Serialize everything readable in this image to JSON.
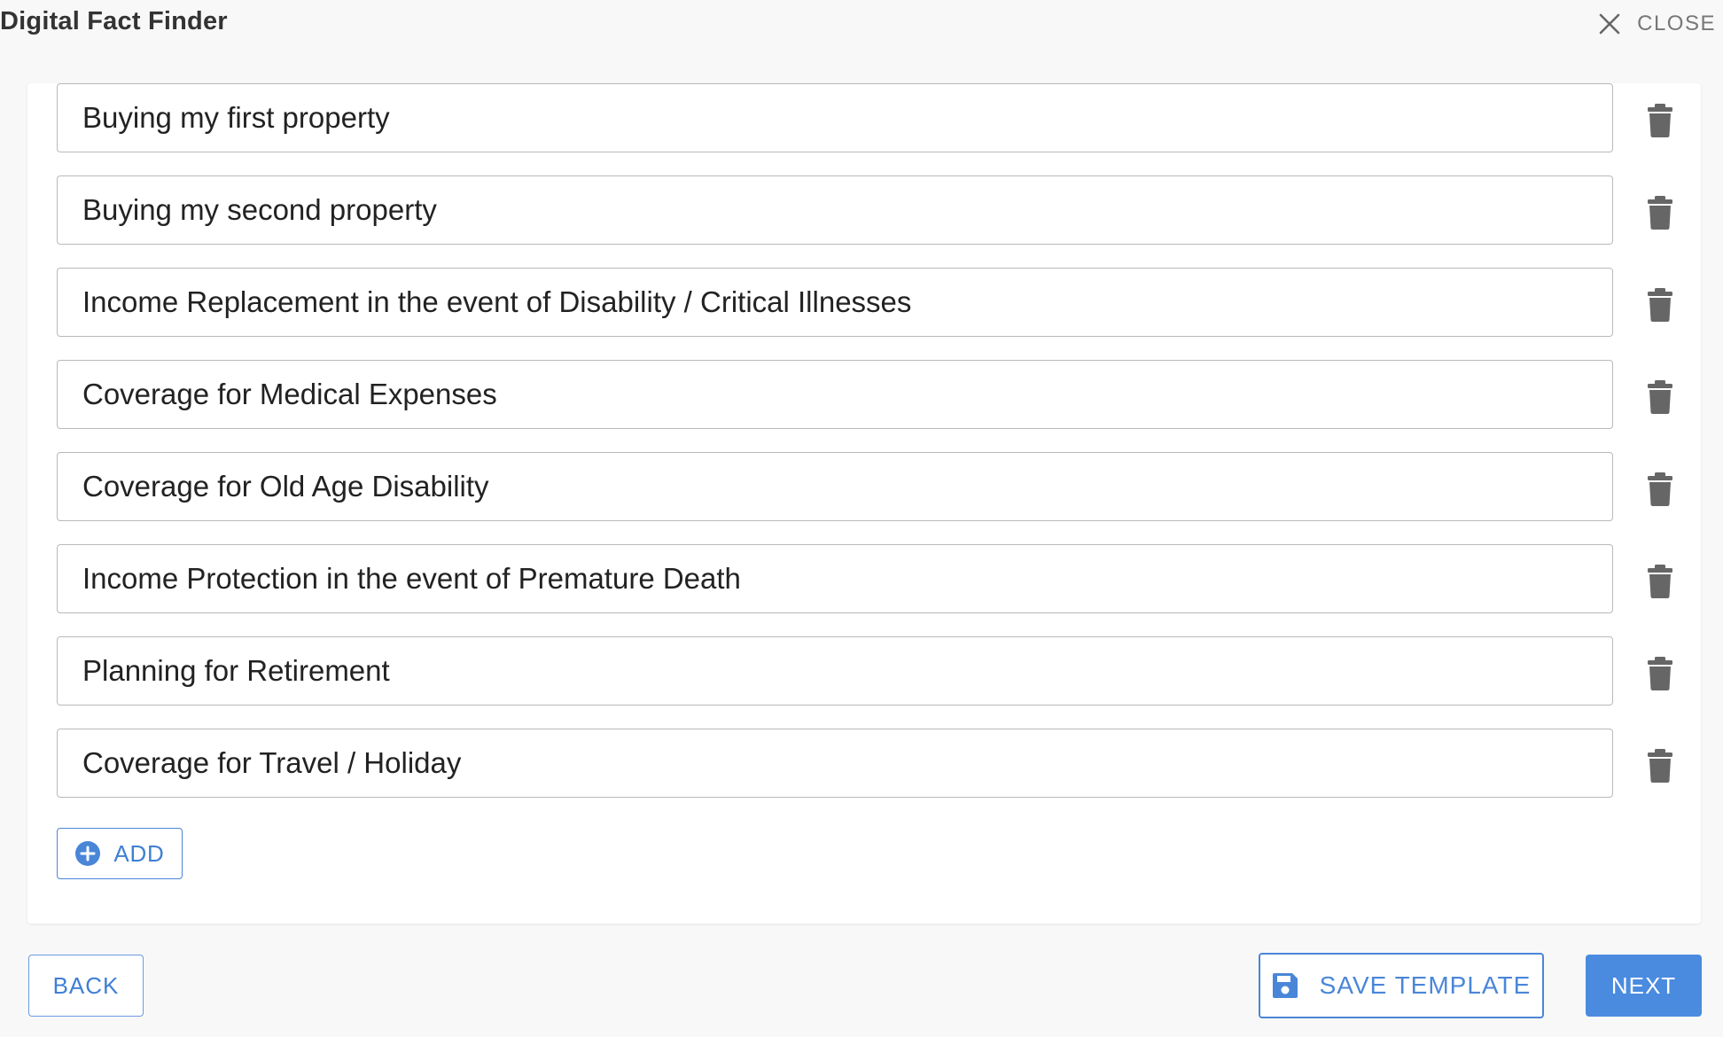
{
  "header": {
    "title": "Digital Fact Finder",
    "close_label": "CLOSE",
    "close_icon": "close-icon"
  },
  "goals": {
    "items": [
      {
        "value": "Buying my first property"
      },
      {
        "value": "Buying my second property"
      },
      {
        "value": "Income Replacement in the event of Disability / Critical Illnesses"
      },
      {
        "value": "Coverage for Medical Expenses"
      },
      {
        "value": "Coverage for Old Age Disability"
      },
      {
        "value": "Income Protection in the event of Premature Death"
      },
      {
        "value": "Planning for Retirement"
      },
      {
        "value": "Coverage for Travel / Holiday"
      }
    ],
    "delete_icon": "trash-icon",
    "add_label": "ADD",
    "add_icon": "plus-circle-icon"
  },
  "footer": {
    "back_label": "BACK",
    "save_label": "SAVE TEMPLATE",
    "save_icon": "floppy-disk-icon",
    "next_label": "NEXT"
  },
  "colors": {
    "accent": "#4a8be0",
    "accent_text": "#3f7fd4",
    "icon_gray": "#666666",
    "background": "#f8f8f8",
    "card": "#ffffff"
  }
}
